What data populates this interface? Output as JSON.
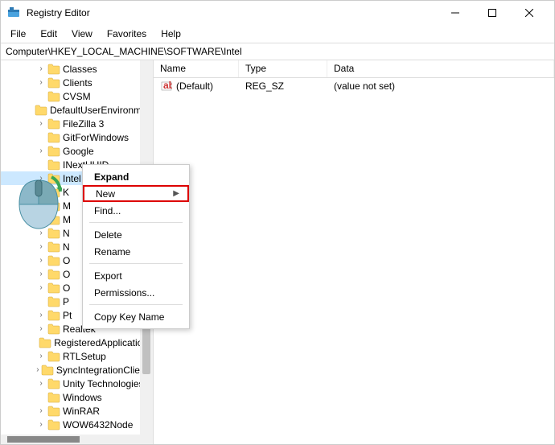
{
  "window": {
    "title": "Registry Editor"
  },
  "menu": {
    "file": "File",
    "edit": "Edit",
    "view": "View",
    "favorites": "Favorites",
    "help": "Help"
  },
  "address": "Computer\\HKEY_LOCAL_MACHINE\\SOFTWARE\\Intel",
  "tree": {
    "items": [
      {
        "label": "Classes",
        "expandable": true,
        "indent": 3
      },
      {
        "label": "Clients",
        "expandable": true,
        "indent": 3
      },
      {
        "label": "CVSM",
        "expandable": false,
        "indent": 3
      },
      {
        "label": "DefaultUserEnvironment",
        "expandable": false,
        "indent": 3
      },
      {
        "label": "FileZilla 3",
        "expandable": true,
        "indent": 3
      },
      {
        "label": "GitForWindows",
        "expandable": false,
        "indent": 3
      },
      {
        "label": "Google",
        "expandable": true,
        "indent": 3
      },
      {
        "label": "INextUUID",
        "expandable": false,
        "indent": 3
      },
      {
        "label": "Intel",
        "expandable": true,
        "indent": 3,
        "selected": true
      },
      {
        "label": "K",
        "expandable": true,
        "indent": 3
      },
      {
        "label": "M",
        "expandable": true,
        "indent": 3
      },
      {
        "label": "M",
        "expandable": true,
        "indent": 3
      },
      {
        "label": "N",
        "expandable": true,
        "indent": 3
      },
      {
        "label": "N",
        "expandable": true,
        "indent": 3
      },
      {
        "label": "O",
        "expandable": true,
        "indent": 3
      },
      {
        "label": "O",
        "expandable": true,
        "indent": 3
      },
      {
        "label": "O",
        "expandable": true,
        "indent": 3
      },
      {
        "label": "P",
        "expandable": false,
        "indent": 3
      },
      {
        "label": "Pt",
        "expandable": true,
        "indent": 3
      },
      {
        "label": "Realtek",
        "expandable": true,
        "indent": 3
      },
      {
        "label": "RegisteredApplications",
        "expandable": false,
        "indent": 3
      },
      {
        "label": "RTLSetup",
        "expandable": true,
        "indent": 3
      },
      {
        "label": "SyncIntegrationClients",
        "expandable": true,
        "indent": 3
      },
      {
        "label": "Unity Technologies",
        "expandable": true,
        "indent": 3
      },
      {
        "label": "Windows",
        "expandable": false,
        "indent": 3
      },
      {
        "label": "WinRAR",
        "expandable": true,
        "indent": 3
      },
      {
        "label": "WOW6432Node",
        "expandable": true,
        "indent": 3
      }
    ]
  },
  "list": {
    "cols": {
      "name": "Name",
      "type": "Type",
      "data": "Data"
    },
    "rows": [
      {
        "name": "(Default)",
        "type": "REG_SZ",
        "data": "(value not set)"
      }
    ]
  },
  "context_menu": {
    "expand": "Expand",
    "new": "New",
    "find": "Find...",
    "delete": "Delete",
    "rename": "Rename",
    "export": "Export",
    "permissions": "Permissions...",
    "copy_key": "Copy Key Name"
  }
}
